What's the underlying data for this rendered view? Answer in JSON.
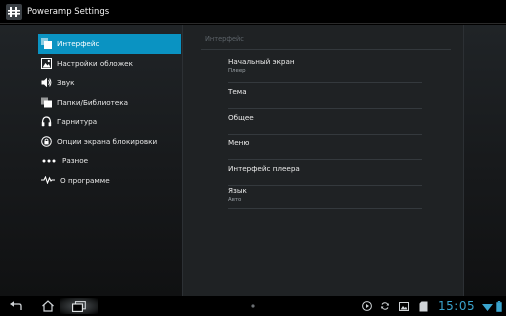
{
  "app": {
    "title": "Poweramp Settings",
    "icon": "poweramp-app-icon"
  },
  "sidebar": {
    "items": [
      {
        "label": "Интерфейс",
        "icon": "interface-icon",
        "active": true
      },
      {
        "label": "Настройки обложек",
        "icon": "album-art-icon",
        "active": false
      },
      {
        "label": "Звук",
        "icon": "speaker-icon",
        "active": false
      },
      {
        "label": "Папки/Библиотека",
        "icon": "folders-icon",
        "active": false
      },
      {
        "label": "Гарнитура",
        "icon": "headset-icon",
        "active": false
      },
      {
        "label": "Опции экрана блокировки",
        "icon": "lock-screen-icon",
        "active": false
      },
      {
        "label": "Разное",
        "icon": "misc-icon",
        "active": false
      },
      {
        "label": "О программе",
        "icon": "about-icon",
        "active": false
      }
    ]
  },
  "panel": {
    "header": "Интерфейс",
    "prefs": [
      {
        "title": "Начальный экран",
        "summary": "Плеер"
      },
      {
        "title": "Тема",
        "summary": ""
      },
      {
        "title": "Общее",
        "summary": ""
      },
      {
        "title": "Меню",
        "summary": ""
      },
      {
        "title": "Интерфейс плеера",
        "summary": ""
      },
      {
        "title": "Язык",
        "summary": "Авто"
      }
    ]
  },
  "status_bar": {
    "time": "15:05"
  },
  "colors": {
    "accent": "#0a93c2",
    "clock": "#3aa4ce"
  }
}
